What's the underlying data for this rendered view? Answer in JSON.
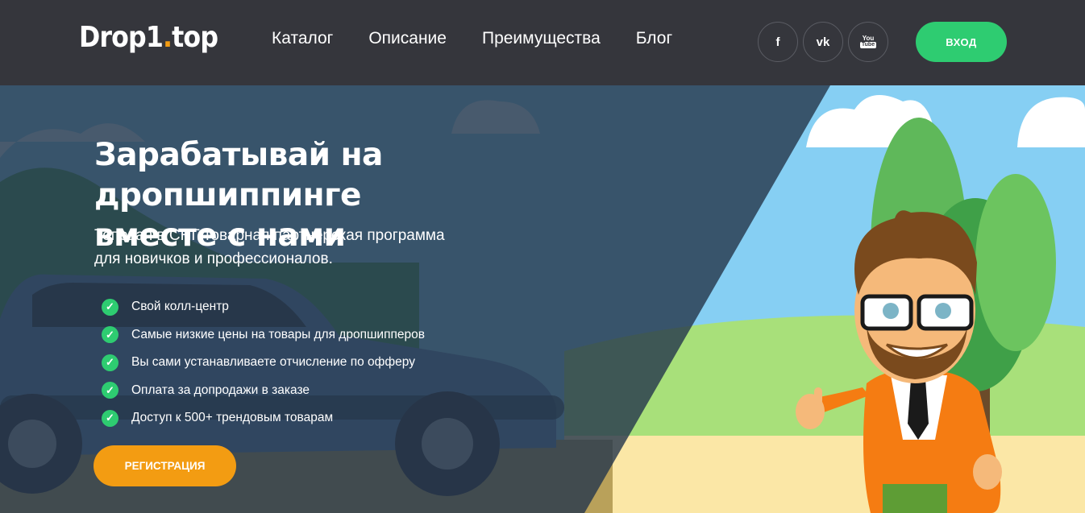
{
  "header": {
    "logo_main": "Drop1",
    "logo_dot": ".",
    "logo_tld": "top",
    "nav": [
      {
        "label": "Каталог"
      },
      {
        "label": "Описание"
      },
      {
        "label": "Преимущества"
      },
      {
        "label": "Блог"
      }
    ],
    "socials": [
      {
        "icon": "facebook-icon",
        "glyph": "f"
      },
      {
        "icon": "vk-icon",
        "glyph": "vk"
      },
      {
        "icon": "youtube-icon",
        "glyph_top": "You",
        "glyph_bottom": "Tube"
      }
    ],
    "login_label": "ВХОД"
  },
  "hero": {
    "title_line1": "Зарабатывай на дропшиппинге",
    "title_line2": "вместе с нами",
    "subtitle_line1": "Топовая в СНГ товарная партнерская программа",
    "subtitle_line2": "для новичков и профессионалов.",
    "features": [
      {
        "text": "Свой колл-центр"
      },
      {
        "text": "Самые низкие цены на товары для дропшипперов"
      },
      {
        "text": "Вы сами устанавливаете отчисление по офферу"
      },
      {
        "text": "Оплата за допродажи в заказе"
      },
      {
        "text": "Доступ к 500+ трендовым товарам"
      }
    ],
    "register_label": "РЕГИСТРАЦИЯ"
  },
  "colors": {
    "header_bg": "#35363c",
    "accent_green": "#2ecc71",
    "accent_orange": "#f39c12",
    "sky": "#8fd0f2",
    "overlay": "#2d3f52"
  }
}
